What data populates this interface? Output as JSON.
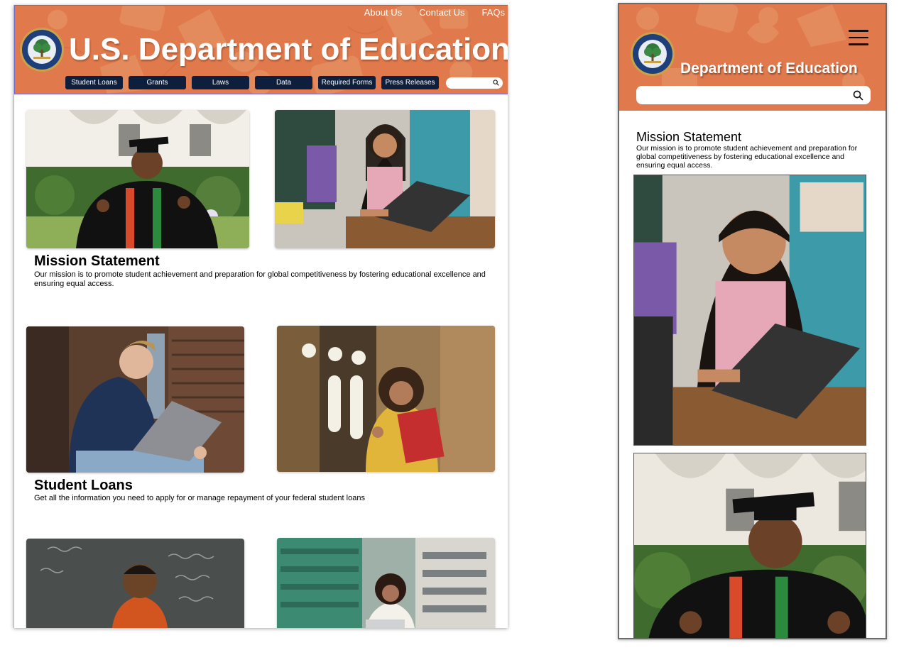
{
  "desktop": {
    "top_nav": [
      "About Us",
      "Contact Us",
      "FAQs"
    ],
    "title": "U.S. Department of Education",
    "nav_buttons": [
      "Student Loans",
      "Grants",
      "Laws",
      "Data",
      "Required Forms",
      "Press Releases"
    ],
    "search": {
      "placeholder": ""
    },
    "sections": [
      {
        "title": "Mission Statement",
        "text": "Our mission is to promote student achievement and preparation for global competitiveness by fostering educational excellence and ensuring equal access."
      },
      {
        "title": "Student Loans",
        "text": "Get all the information you need to apply for or manage repayment of your federal student loans"
      }
    ]
  },
  "mobile": {
    "title": "Department of Education",
    "search": {
      "placeholder": ""
    },
    "heading": "Mission Statement",
    "text": "Our mission is to promote student achievement and preparation for global competitiveness by fostering educational excellence and ensuring equal access."
  },
  "icons": [
    "education-seal-icon",
    "search-icon",
    "hamburger-menu-icon"
  ],
  "colors": {
    "header_orange": "#e07a4c",
    "nav_button_navy": "#0d1f3c",
    "selection_outline": "#6e68d9"
  }
}
